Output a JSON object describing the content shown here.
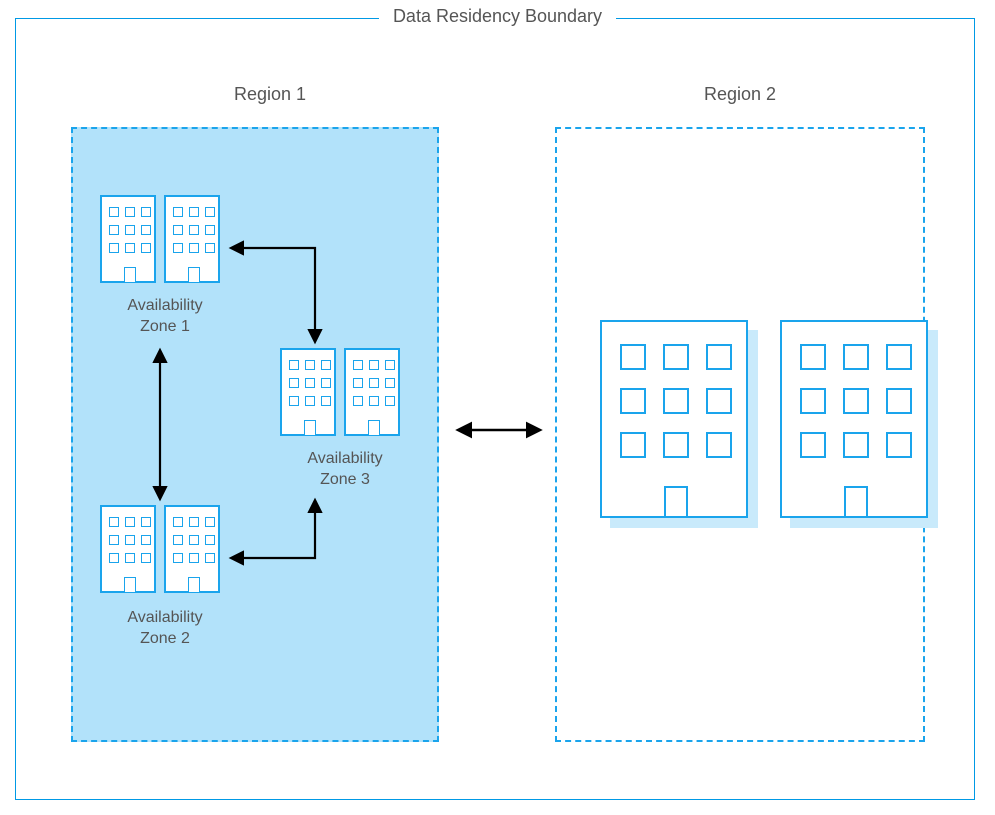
{
  "boundary_title": "Data Residency Boundary",
  "region1": {
    "title": "Region 1",
    "az1": "Availability\nZone 1",
    "az2": "Availability\nZone 2",
    "az3": "Availability\nZone 3"
  },
  "region2": {
    "title": "Region 2"
  },
  "colors": {
    "azure_blue": "#1aa4ec",
    "fill_light": "#b2e2fa",
    "arrow": "#000000"
  }
}
